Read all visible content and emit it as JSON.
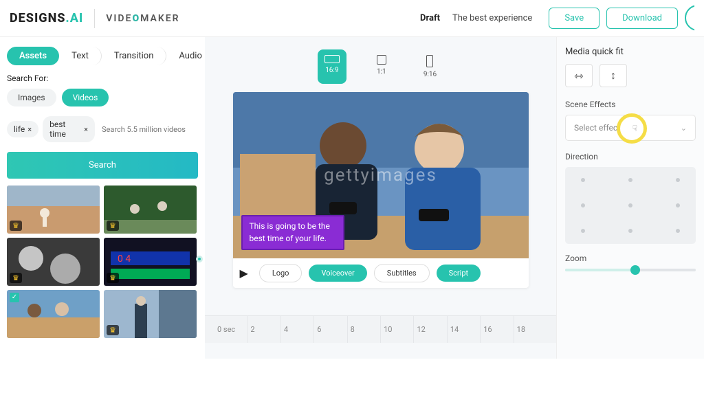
{
  "header": {
    "logo_main": "DESIGNS",
    "logo_suffix": ".AI",
    "product_prefix": "VIDE",
    "product_mid": "O",
    "product_suffix": "MAKER",
    "draft": "Draft",
    "subtitle": "The best experience",
    "save": "Save",
    "download": "Download"
  },
  "sidebar": {
    "tabs": [
      "Assets",
      "Text",
      "Transition",
      "Audio"
    ],
    "search_for": "Search For:",
    "media_pills": [
      "Images",
      "Videos"
    ],
    "tags": [
      "life",
      "best time"
    ],
    "tag_close": "×",
    "search_hint": "Search 5.5 million videos",
    "search_btn": "Search"
  },
  "aspect": {
    "r169": "16:9",
    "r11": "1:1",
    "r916": "9:16"
  },
  "preview": {
    "caption": "This is going to be the best time of your life.",
    "watermark": "gettyimages",
    "controls": {
      "logo": "Logo",
      "voiceover": "Voiceover",
      "subtitles": "Subtitles",
      "script": "Script"
    }
  },
  "timeline": [
    "0 sec",
    "2",
    "4",
    "6",
    "8",
    "10",
    "12",
    "14",
    "16",
    "18"
  ],
  "right": {
    "media_fit": "Media quick fit",
    "scene_effects": "Scene Effects",
    "select_effect": "Select effect",
    "direction": "Direction",
    "zoom": "Zoom"
  },
  "icons": {
    "fit_h": "⇿",
    "fit_v": "↕",
    "play": "▶",
    "chev": "⌄",
    "crown": "♛",
    "check": "✓",
    "hand": "☟"
  }
}
